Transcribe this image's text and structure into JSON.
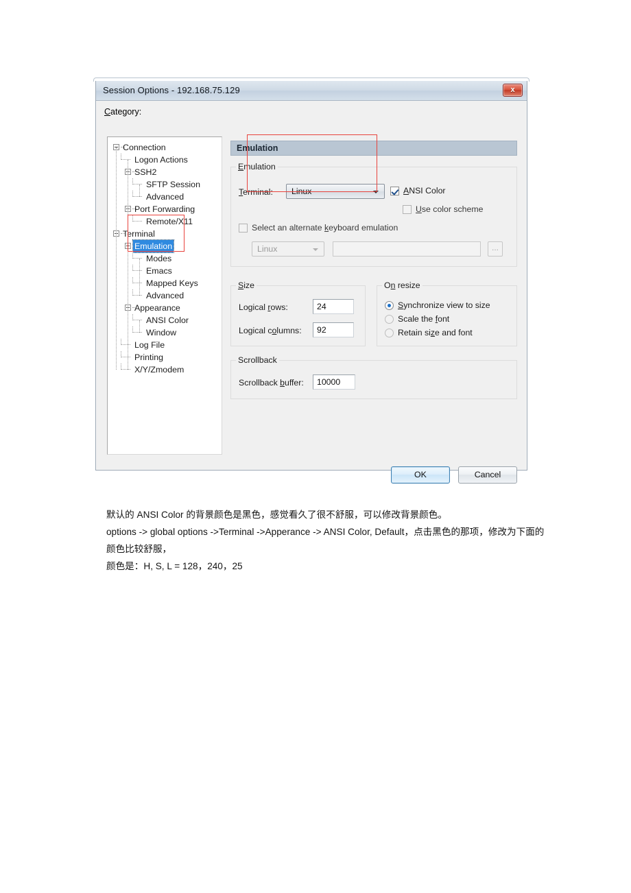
{
  "window": {
    "title": "Session Options - 192.168.75.129",
    "close_label": "x",
    "close_icon": "close-icon"
  },
  "category": {
    "label": "Category:"
  },
  "tree": {
    "items": [
      {
        "label": "Connection",
        "depth": 0,
        "expander": "collapse",
        "selected": false
      },
      {
        "label": "Logon Actions",
        "depth": 1,
        "expander": "none",
        "selected": false
      },
      {
        "label": "SSH2",
        "depth": 1,
        "expander": "collapse",
        "selected": false
      },
      {
        "label": "SFTP Session",
        "depth": 2,
        "expander": "none",
        "selected": false
      },
      {
        "label": "Advanced",
        "depth": 2,
        "expander": "none",
        "selected": false
      },
      {
        "label": "Port Forwarding",
        "depth": 1,
        "expander": "collapse",
        "selected": false
      },
      {
        "label": "Remote/X11",
        "depth": 2,
        "expander": "none",
        "selected": false
      },
      {
        "label": "Terminal",
        "depth": 0,
        "expander": "collapse",
        "selected": false
      },
      {
        "label": "Emulation",
        "depth": 1,
        "expander": "collapse",
        "selected": true
      },
      {
        "label": "Modes",
        "depth": 2,
        "expander": "none",
        "selected": false
      },
      {
        "label": "Emacs",
        "depth": 2,
        "expander": "none",
        "selected": false
      },
      {
        "label": "Mapped Keys",
        "depth": 2,
        "expander": "none",
        "selected": false
      },
      {
        "label": "Advanced",
        "depth": 2,
        "expander": "none",
        "selected": false
      },
      {
        "label": "Appearance",
        "depth": 1,
        "expander": "collapse",
        "selected": false
      },
      {
        "label": "ANSI Color",
        "depth": 2,
        "expander": "none",
        "selected": false
      },
      {
        "label": "Window",
        "depth": 2,
        "expander": "none",
        "selected": false
      },
      {
        "label": "Log File",
        "depth": 1,
        "expander": "none",
        "selected": false
      },
      {
        "label": "Printing",
        "depth": 1,
        "expander": "none",
        "selected": false
      },
      {
        "label": "X/Y/Zmodem",
        "depth": 1,
        "expander": "none",
        "selected": false
      }
    ]
  },
  "pane": {
    "header": "Emulation",
    "emulation_group": {
      "title": "Emulation",
      "terminal_label": "Terminal:",
      "terminal_value": "Linux",
      "ansi_color_label": "ANSI Color",
      "ansi_color_checked": true,
      "use_color_scheme_label": "Use color scheme",
      "use_color_scheme_checked": false,
      "alt_keyboard_label": "Select an alternate keyboard emulation",
      "alt_keyboard_checked": false,
      "alt_keyboard_value": "Linux",
      "alt_keyboard_path": "",
      "browse_label": "..."
    },
    "size_group": {
      "title": "Size",
      "rows_label": "Logical rows:",
      "rows_value": "24",
      "cols_label": "Logical columns:",
      "cols_value": "92"
    },
    "resize_group": {
      "title": "On resize",
      "options": [
        {
          "label": "Synchronize view to size",
          "selected": true
        },
        {
          "label": "Scale the font",
          "selected": false
        },
        {
          "label": "Retain size and font",
          "selected": false
        }
      ]
    },
    "scrollback_group": {
      "title": "Scrollback",
      "buffer_label": "Scrollback buffer:",
      "buffer_value": "10000"
    }
  },
  "footer": {
    "ok_label": "OK",
    "cancel_label": "Cancel"
  },
  "annotations": {
    "accent_color": "#e8423c",
    "boxes": [
      {
        "name": "tree-emulation-highlight"
      },
      {
        "name": "terminal-dropdown-highlight"
      }
    ]
  },
  "caption": {
    "line1": "默认的 ANSI Color 的背景颜色是黑色，感觉看久了很不舒服，可以修改背景颜色。",
    "line2": "options -> global options ->Terminal ->Apperance -> ANSI Color, Default，点击黑色的那项，修改为下面的颜色比较舒服，",
    "line3": "颜色是：H, S, L = 128，240，25"
  }
}
